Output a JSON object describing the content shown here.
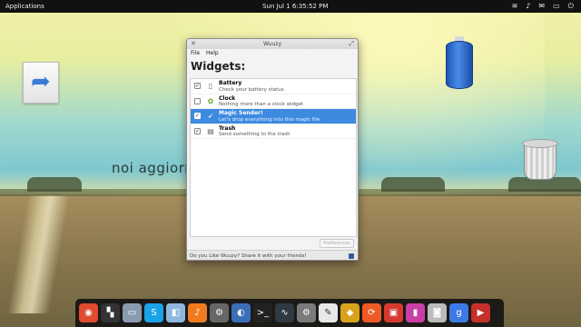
{
  "top_panel": {
    "applications_label": "Applications",
    "clock": "Sun Jul  1  6:35:52 PM",
    "indicators": [
      "wifi-icon",
      "sound-icon",
      "mail-icon",
      "battery-icon",
      "power-icon"
    ],
    "indicator_glyphs": [
      "≋",
      "♪",
      "✉",
      "▭",
      "⏻"
    ]
  },
  "desktop": {
    "watermark": "noi aggiorniamo",
    "icons": [
      "document-icon",
      "battery-icon",
      "trash-icon"
    ]
  },
  "window": {
    "title": "Wuuzy",
    "menu": [
      "File",
      "Help"
    ],
    "heading": "Widgets:",
    "widgets": [
      {
        "name": "Battery",
        "description": "Check your battery status.",
        "checked": true,
        "icon": "battery-icon",
        "glyph": "▯"
      },
      {
        "name": "Clock",
        "description": "Nothing more than a clock widget",
        "checked": false,
        "icon": "clock-leaf-icon",
        "glyph": "✿"
      },
      {
        "name": "Magic Sender!",
        "description": "Let's drop everything into this magic file",
        "checked": true,
        "icon": "paper-plane-icon",
        "glyph": "➶"
      },
      {
        "name": "Trash",
        "description": "Send something to the trash",
        "checked": true,
        "icon": "trash-icon",
        "glyph": "▤"
      }
    ],
    "preferences_button": "Preferences",
    "status_text": "Do you Like Wuuzy? Share it with your friends!"
  },
  "dock": {
    "items": [
      {
        "name": "chrome-icon",
        "glyph": "◉",
        "color": "#e04a2f"
      },
      {
        "name": "dashboard-icon",
        "glyph": "▚",
        "color": "#333333"
      },
      {
        "name": "files-icon",
        "glyph": "▭",
        "color": "#8a9bb0"
      },
      {
        "name": "skype-icon",
        "glyph": "S",
        "color": "#1aa3e8"
      },
      {
        "name": "finder-icon",
        "glyph": "◧",
        "color": "#8fb6de"
      },
      {
        "name": "music-icon",
        "glyph": "♪",
        "color": "#f07b1f"
      },
      {
        "name": "settings-icon",
        "glyph": "⚙",
        "color": "#666666"
      },
      {
        "name": "eclipse-icon",
        "glyph": "◐",
        "color": "#3a6fb7"
      },
      {
        "name": "terminal-icon",
        "glyph": ">_",
        "color": "#222222"
      },
      {
        "name": "system-monitor-icon",
        "glyph": "∿",
        "color": "#2e3a44"
      },
      {
        "name": "system-settings-icon",
        "glyph": "⚙",
        "color": "#7a7a7a"
      },
      {
        "name": "text-editor-icon",
        "glyph": "✎",
        "color": "#e8e8e8"
      },
      {
        "name": "emerald-icon",
        "glyph": "◆",
        "color": "#d9a21c"
      },
      {
        "name": "sync-icon",
        "glyph": "⟳",
        "color": "#ef5a24"
      },
      {
        "name": "presentation-icon",
        "glyph": "▣",
        "color": "#d63a2f"
      },
      {
        "name": "notebook-icon",
        "glyph": "▮",
        "color": "#c93ea5"
      },
      {
        "name": "camera-icon",
        "glyph": "◙",
        "color": "#bbbbbb"
      },
      {
        "name": "google-icon",
        "glyph": "g",
        "color": "#3c79e6"
      },
      {
        "name": "media-player-icon",
        "glyph": "▶",
        "color": "#c4302b"
      }
    ]
  }
}
